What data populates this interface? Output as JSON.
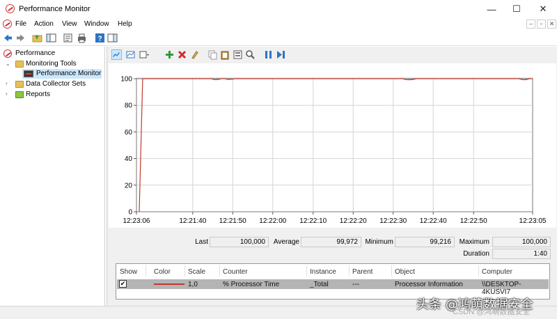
{
  "window": {
    "title": "Performance Monitor",
    "minimize": "—",
    "maximize": "☐",
    "close": "✕"
  },
  "menu": {
    "items": [
      "File",
      "Action",
      "View",
      "Window",
      "Help"
    ],
    "mdi_minimize": "–",
    "mdi_restore": "▫",
    "mdi_close": "✕"
  },
  "toolbar": {
    "icons": [
      "back-icon",
      "forward-icon",
      "up-folder-icon",
      "show-hide-tree-icon",
      "properties-icon",
      "print-icon",
      "help-icon",
      "show-hide-action-pane-icon"
    ]
  },
  "tree": {
    "root": "Performance",
    "monitoring_tools": "Monitoring Tools",
    "performance_monitor": "Performance Monitor",
    "data_collector_sets": "Data Collector Sets",
    "reports": "Reports"
  },
  "graph_toolbar": {
    "icons": [
      "view-current-activity-icon",
      "change-graph-type-icon",
      "graph-type-dropdown-icon",
      "add-counter-icon",
      "delete-counter-icon",
      "highlight-icon",
      "copy-properties-icon",
      "paste-counter-list-icon",
      "properties-icon",
      "zoom-icon",
      "freeze-display-icon",
      "update-data-icon"
    ]
  },
  "chart_data": {
    "type": "line",
    "x_ticks": [
      "12:23:06",
      "12:21:40",
      "12:21:50",
      "12:22:00",
      "12:22:10",
      "12:22:20",
      "12:22:30",
      "12:22:40",
      "12:22:50",
      "12:23:05"
    ],
    "y_ticks": [
      "100",
      "80",
      "60",
      "40",
      "20",
      "0"
    ],
    "ylim": [
      0,
      100
    ],
    "grid": true,
    "series": [
      {
        "name": "% Processor Time",
        "color": "#c0392b",
        "values": [
          0,
          100,
          100,
          100,
          100,
          100,
          100,
          100,
          100,
          100,
          100,
          100,
          100,
          100,
          100,
          100,
          100,
          100,
          100,
          100,
          100,
          100,
          99.3,
          99.4,
          100,
          100,
          99.5,
          99.6,
          100,
          100,
          100,
          100,
          100,
          100,
          100,
          100,
          100,
          100,
          100,
          100,
          100,
          100,
          100,
          100,
          100,
          100,
          100,
          100,
          100,
          100,
          100,
          100,
          100,
          100,
          100,
          100,
          100,
          100,
          100,
          100,
          100,
          100,
          100,
          100,
          100,
          100,
          100,
          100,
          100,
          100,
          100,
          100,
          100,
          100,
          100,
          100,
          100,
          100,
          99.3,
          99.2,
          99.4,
          100,
          100,
          100,
          100,
          100,
          100,
          100,
          100,
          100,
          100,
          100,
          100,
          100,
          100,
          100,
          100,
          100,
          100,
          100,
          100,
          100,
          100,
          100,
          100,
          100,
          100,
          100,
          100,
          100,
          100,
          100,
          99.3,
          99.2,
          100,
          100
        ]
      }
    ]
  },
  "stats": {
    "last_label": "Last",
    "last_value": "100,000",
    "average_label": "Average",
    "average_value": "99,972",
    "minimum_label": "Minimum",
    "minimum_value": "99,216",
    "maximum_label": "Maximum",
    "maximum_value": "100,000",
    "duration_label": "Duration",
    "duration_value": "1:40"
  },
  "counters": {
    "headers": [
      "Show",
      "Color",
      "Scale",
      "Counter",
      "Instance",
      "Parent",
      "Object",
      "Computer"
    ],
    "rows": [
      {
        "show": "✔",
        "color": "#c0392b",
        "scale": "1,0",
        "counter": "% Processor Time",
        "instance": "_Total",
        "parent": "---",
        "object": "Processor Information",
        "computer": "\\\\DESKTOP-4KUSVI7"
      }
    ]
  },
  "watermark": {
    "main": "头条 @鸿萌数据安全",
    "sub": "CSDN @鸿萌数据安全"
  }
}
